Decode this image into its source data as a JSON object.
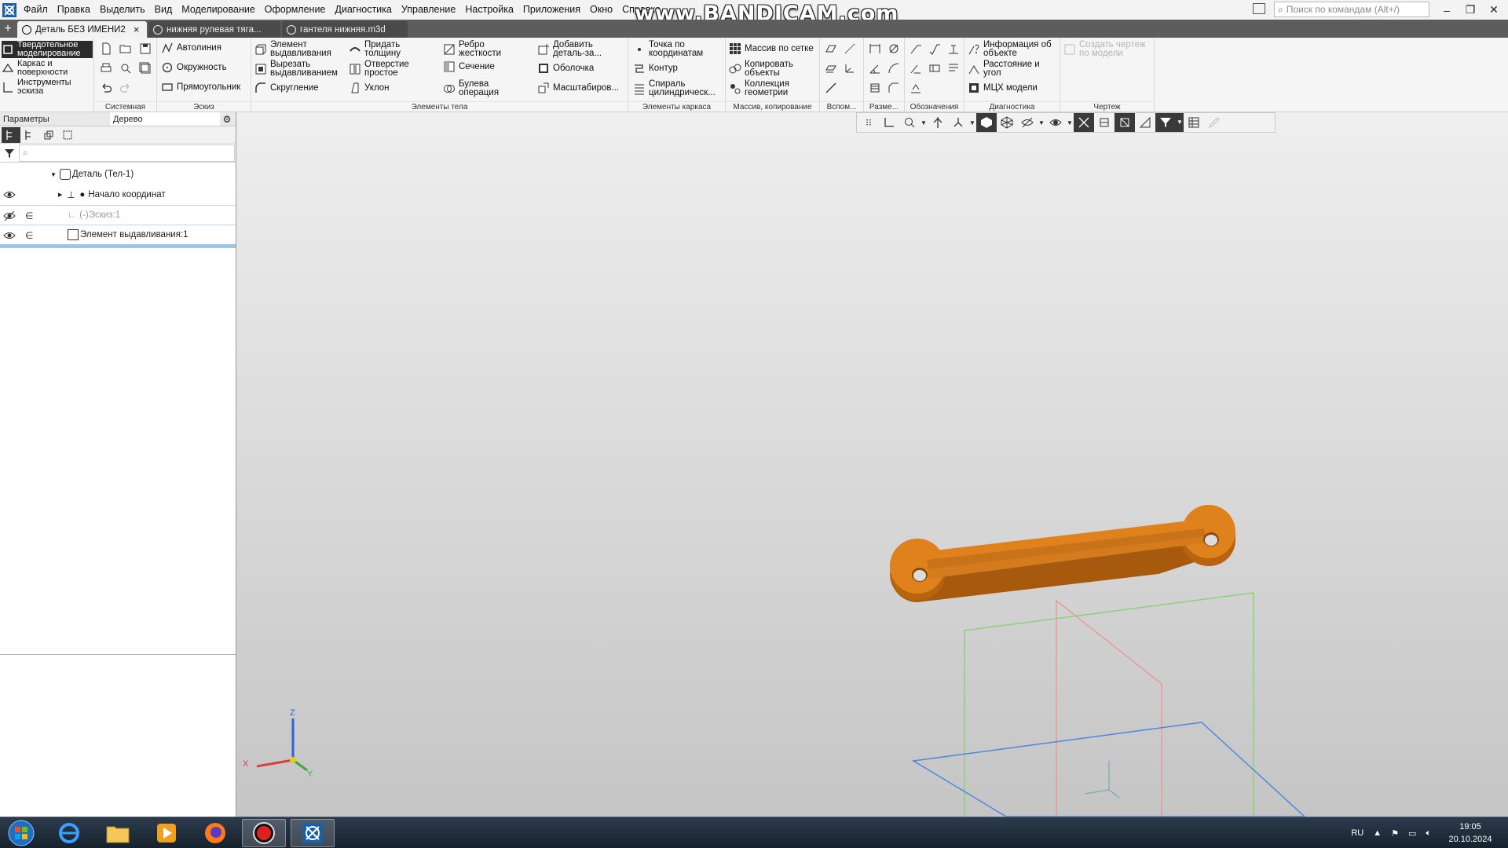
{
  "menu": [
    "Файл",
    "Правка",
    "Выделить",
    "Вид",
    "Моделирование",
    "Оформление",
    "Диагностика",
    "Управление",
    "Настройка",
    "Приложения",
    "Окно",
    "Справка"
  ],
  "watermark": "www.BANDICAM.com",
  "search_placeholder": "Поиск по командам (Alt+/)",
  "window_controls": [
    "–",
    "❐",
    "✕"
  ],
  "tabs": [
    {
      "label": "Деталь БЕЗ ИМЕНИ2",
      "active": true,
      "close": "×"
    },
    {
      "label": "нижняя рулевая тяга...",
      "active": false
    },
    {
      "label": "гантеля нижняя.m3d",
      "active": false
    }
  ],
  "ribbon": {
    "modes": [
      "Твердотельное моделирование",
      "Каркас и поверхности",
      "Инструменты эскиза"
    ],
    "groups": {
      "system": "Системная",
      "sketch": "Эскиз",
      "body": "Элементы тела",
      "frame": "Элементы каркаса",
      "array": "Массив, копирование",
      "aux": "Вспом...",
      "dims": "Разме...",
      "notation": "Обозначения",
      "diag": "Диагностика",
      "drawing": "Чертеж"
    },
    "sketch_buttons": [
      "Автолиния",
      "Окружность",
      "Прямоугольник"
    ],
    "body_col1": [
      "Элемент выдавливания",
      "Вырезать выдавливанием",
      "Скругление"
    ],
    "body_col2": [
      "Придать толщину",
      "Отверстие простое",
      "Уклон"
    ],
    "body_col3": [
      "Ребро жесткости",
      "Сечение",
      "Булева операция"
    ],
    "body_col4": [
      "Добавить деталь-за...",
      "Оболочка",
      "Масштабиров..."
    ],
    "frame_buttons": [
      "Точка по координатам",
      "Контур",
      "Спираль цилиндрическ..."
    ],
    "array_buttons": [
      "Массив по сетке",
      "Копировать объекты",
      "Коллекция геометрии"
    ],
    "diag_buttons": [
      "Информация об объекте",
      "Расстояние и угол",
      "МЦХ модели"
    ],
    "drawing_button": "Создать чертеж по модели"
  },
  "panel": {
    "tabs": [
      "Параметры",
      "Дерево"
    ],
    "tree": [
      {
        "label": "Деталь (Тел-1)"
      },
      {
        "label": "Начало координат"
      },
      {
        "label": "(-)Эскиз:1"
      },
      {
        "label": "Элемент выдавливания:1"
      }
    ]
  },
  "axes": {
    "x": "X",
    "y": "Y",
    "z": "Z"
  },
  "colors": {
    "part": "#e0821c",
    "part_side": "#a85a0c",
    "accent_tab": "#9cc7e6"
  },
  "taskbar": {
    "lang": "RU",
    "time": "19:05",
    "date": "20.10.2024"
  }
}
